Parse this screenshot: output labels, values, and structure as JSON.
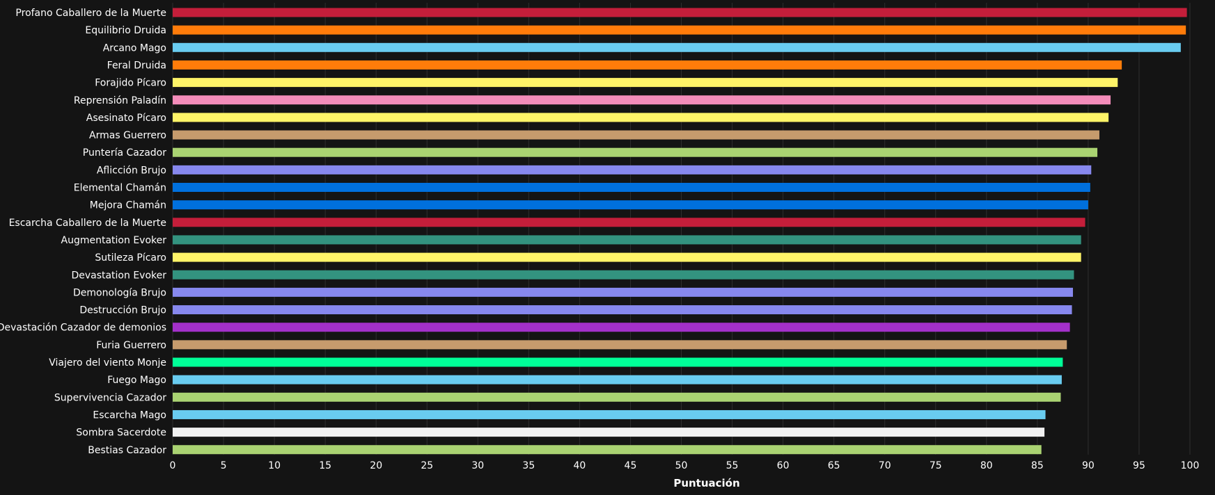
{
  "chart_data": {
    "type": "bar",
    "orientation": "horizontal",
    "xlabel": "Puntuación",
    "ylabel": "",
    "xlim": [
      0,
      100
    ],
    "xticks": [
      0,
      5,
      10,
      15,
      20,
      25,
      30,
      35,
      40,
      45,
      50,
      55,
      60,
      65,
      70,
      75,
      80,
      85,
      90,
      95,
      100
    ],
    "grid": "vertical",
    "categories": [
      "Profano Caballero de la Muerte",
      "Equilibrio Druida",
      "Arcano Mago",
      "Feral Druida",
      "Forajido Pícaro",
      "Reprensión Paladín",
      "Asesinato Pícaro",
      "Armas Guerrero",
      "Puntería Cazador",
      "Aflicción Brujo",
      "Elemental Chamán",
      "Mejora Chamán",
      "Escarcha Caballero de la Muerte",
      "Augmentation Evoker",
      "Sutileza Pícaro",
      "Devastation Evoker",
      "Demonología Brujo",
      "Destrucción Brujo",
      "Devastación Cazador de demonios",
      "Furia Guerrero",
      "Viajero del viento Monje",
      "Fuego Mago",
      "Supervivencia Cazador",
      "Escarcha Mago",
      "Sombra Sacerdote",
      "Bestias Cazador"
    ],
    "values": [
      99.7,
      99.6,
      99.1,
      93.3,
      92.9,
      92.2,
      92.0,
      91.1,
      90.9,
      90.3,
      90.2,
      90.0,
      89.7,
      89.3,
      89.3,
      88.6,
      88.5,
      88.4,
      88.2,
      87.9,
      87.5,
      87.4,
      87.3,
      85.8,
      85.7,
      85.4
    ],
    "colors": [
      "#c41e3a",
      "#ff7c0a",
      "#69ccf0",
      "#ff7c0a",
      "#fff468",
      "#f48cba",
      "#fff468",
      "#c69b6d",
      "#aad372",
      "#8788ee",
      "#0070dd",
      "#0070dd",
      "#c41e3a",
      "#33937f",
      "#fff468",
      "#33937f",
      "#8788ee",
      "#8788ee",
      "#a330c9",
      "#c69b6d",
      "#00ff98",
      "#69ccf0",
      "#aad372",
      "#69ccf0",
      "#f0f0f0",
      "#aad372"
    ]
  },
  "theme": {
    "background": "#141414",
    "text": "#ffffff",
    "grid": "#2e2e2e"
  }
}
